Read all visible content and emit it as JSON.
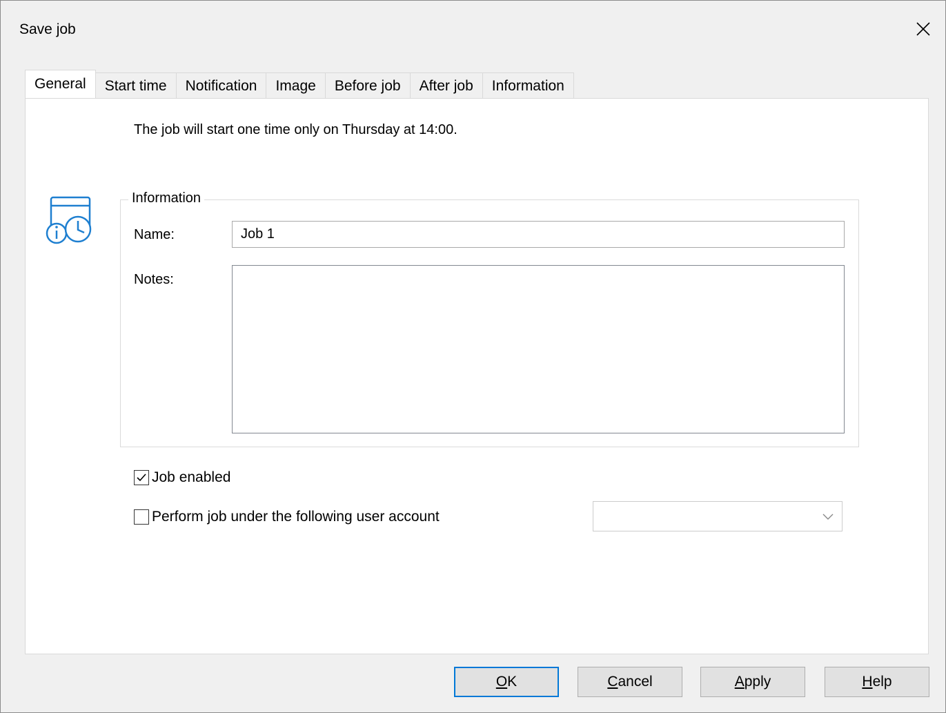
{
  "window": {
    "title": "Save job"
  },
  "tabs": [
    {
      "label": "General",
      "active": true
    },
    {
      "label": "Start time"
    },
    {
      "label": "Notification"
    },
    {
      "label": "Image"
    },
    {
      "label": "Before job"
    },
    {
      "label": "After job"
    },
    {
      "label": "Information"
    }
  ],
  "general": {
    "description": "The job will start one time only on Thursday at 14:00.",
    "icon": "calendar-clock-info-icon",
    "info_group": {
      "legend": "Information",
      "name_label": "Name:",
      "name_value": "Job 1",
      "notes_label": "Notes:",
      "notes_value": ""
    },
    "job_enabled": {
      "label": "Job enabled",
      "checked": true
    },
    "user_account": {
      "label": "Perform job under the following user account",
      "checked": false,
      "selected": ""
    }
  },
  "buttons": {
    "ok": {
      "mnemonic": "O",
      "rest": "K"
    },
    "cancel": {
      "mnemonic": "C",
      "rest": "ancel"
    },
    "apply": {
      "mnemonic": "A",
      "rest": "pply"
    },
    "help": {
      "mnemonic": "H",
      "rest": "elp"
    }
  },
  "colors": {
    "accent": "#0078d7",
    "icon": "#1e7fd0"
  }
}
